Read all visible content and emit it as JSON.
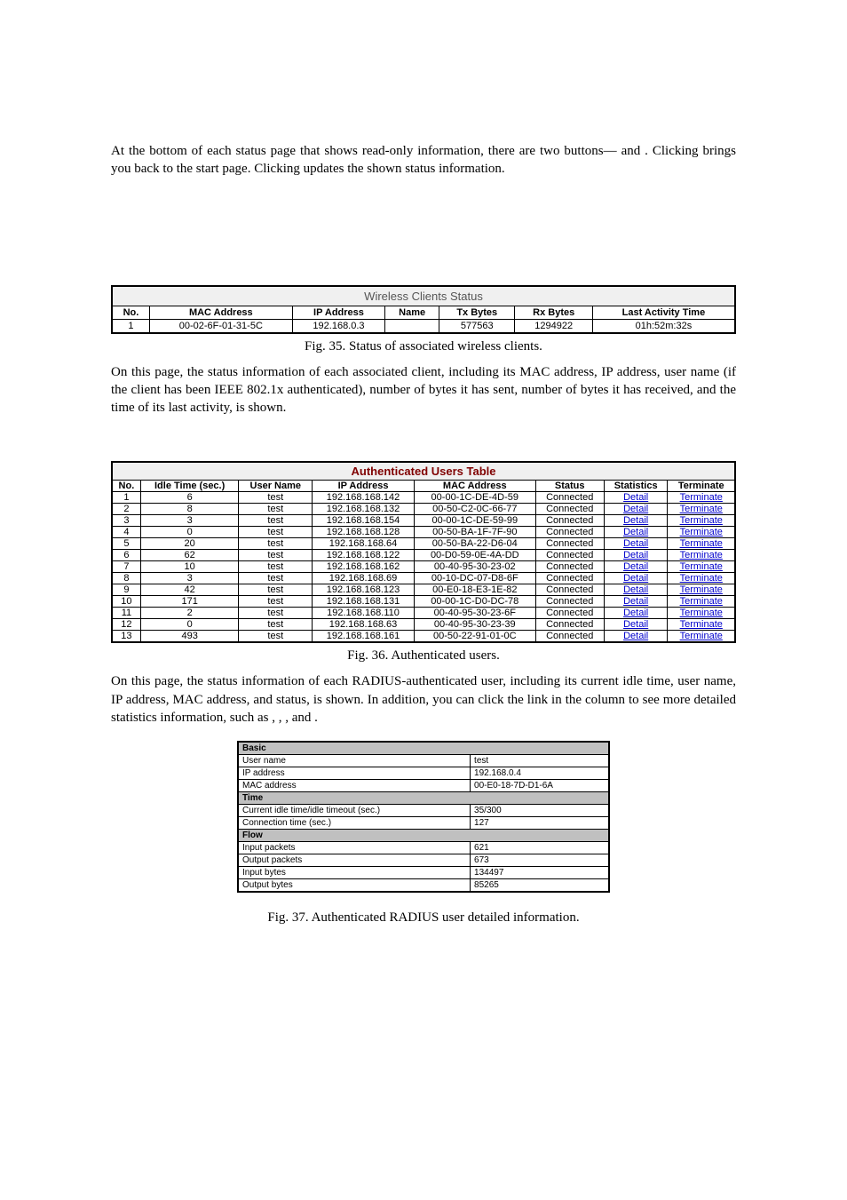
{
  "para1_a": "At the bottom of each status page that shows read-only information, there are two buttons—",
  "para1_b": " and ",
  "para1_c": ". Clicking ",
  "para1_d": " brings you back to the start page. Clicking ",
  "para1_e": " updates the shown status information.",
  "wireless": {
    "title": "Wireless Clients Status",
    "headers": [
      "No.",
      "MAC Address",
      "IP Address",
      "Name",
      "Tx Bytes",
      "Rx Bytes",
      "Last Activity Time"
    ],
    "rows": [
      {
        "no": "1",
        "mac": "00-02-6F-01-31-5C",
        "ip": "192.168.0.3",
        "name": "",
        "tx": "577563",
        "rx": "1294922",
        "last": "01h:52m:32s"
      }
    ]
  },
  "fig35": "Fig. 35. Status of associated wireless clients.",
  "para2": "On this page, the status information of each associated client, including its MAC address, IP address, user name (if the client has been IEEE 802.1x authenticated), number of bytes it has sent, number of bytes it has received, and the time of its last activity, is shown.",
  "auth": {
    "title": "Authenticated Users Table",
    "headers": [
      "No.",
      "Idle Time (sec.)",
      "User Name",
      "IP Address",
      "MAC Address",
      "Status",
      "Statistics",
      "Terminate"
    ],
    "rows": [
      {
        "no": "1",
        "idle": "6",
        "user": "test",
        "ip": "192.168.168.142",
        "mac": "00-00-1C-DE-4D-59",
        "status": "Connected"
      },
      {
        "no": "2",
        "idle": "8",
        "user": "test",
        "ip": "192.168.168.132",
        "mac": "00-50-C2-0C-66-77",
        "status": "Connected"
      },
      {
        "no": "3",
        "idle": "3",
        "user": "test",
        "ip": "192.168.168.154",
        "mac": "00-00-1C-DE-59-99",
        "status": "Connected"
      },
      {
        "no": "4",
        "idle": "0",
        "user": "test",
        "ip": "192.168.168.128",
        "mac": "00-50-BA-1F-7F-90",
        "status": "Connected"
      },
      {
        "no": "5",
        "idle": "20",
        "user": "test",
        "ip": "192.168.168.64",
        "mac": "00-50-BA-22-D6-04",
        "status": "Connected"
      },
      {
        "no": "6",
        "idle": "62",
        "user": "test",
        "ip": "192.168.168.122",
        "mac": "00-D0-59-0E-4A-DD",
        "status": "Connected"
      },
      {
        "no": "7",
        "idle": "10",
        "user": "test",
        "ip": "192.168.168.162",
        "mac": "00-40-95-30-23-02",
        "status": "Connected"
      },
      {
        "no": "8",
        "idle": "3",
        "user": "test",
        "ip": "192.168.168.69",
        "mac": "00-10-DC-07-D8-6F",
        "status": "Connected"
      },
      {
        "no": "9",
        "idle": "42",
        "user": "test",
        "ip": "192.168.168.123",
        "mac": "00-E0-18-E3-1E-82",
        "status": "Connected"
      },
      {
        "no": "10",
        "idle": "171",
        "user": "test",
        "ip": "192.168.168.131",
        "mac": "00-00-1C-D0-DC-78",
        "status": "Connected"
      },
      {
        "no": "11",
        "idle": "2",
        "user": "test",
        "ip": "192.168.168.110",
        "mac": "00-40-95-30-23-6F",
        "status": "Connected"
      },
      {
        "no": "12",
        "idle": "0",
        "user": "test",
        "ip": "192.168.168.63",
        "mac": "00-40-95-30-23-39",
        "status": "Connected"
      },
      {
        "no": "13",
        "idle": "493",
        "user": "test",
        "ip": "192.168.168.161",
        "mac": "00-50-22-91-01-0C",
        "status": "Connected"
      }
    ],
    "detail_label": "Detail",
    "terminate_label": "Terminate"
  },
  "fig36": "Fig. 36. Authenticated users.",
  "para3_a": "On this page, the status information of each RADIUS-authenticated user, including its current idle time, user name, IP address, MAC address, and status, is shown. In addition, you can click the ",
  "para3_b": " link in the ",
  "para3_c": " column to see more detailed statistics information, such as ",
  "para3_d": ", ",
  "para3_e": ", ",
  "para3_f": ", and ",
  "para3_g": ".",
  "detail": {
    "sections": {
      "basic": "Basic",
      "time": "Time",
      "flow": "Flow"
    },
    "username_l": "User name",
    "username_v": "test",
    "ip_l": "IP address",
    "ip_v": "192.168.0.4",
    "mac_l": "MAC address",
    "mac_v": "00-E0-18-7D-D1-6A",
    "idle_l": "Current idle time/idle timeout (sec.)",
    "idle_v": "35/300",
    "conn_l": "Connection time (sec.)",
    "conn_v": "127",
    "inpk_l": "Input packets",
    "inpk_v": "621",
    "outpk_l": "Output packets",
    "outpk_v": "673",
    "inbt_l": "Input bytes",
    "inbt_v": "134497",
    "outbt_l": "Output bytes",
    "outbt_v": "85265"
  },
  "fig37": "Fig. 37. Authenticated RADIUS user detailed information."
}
